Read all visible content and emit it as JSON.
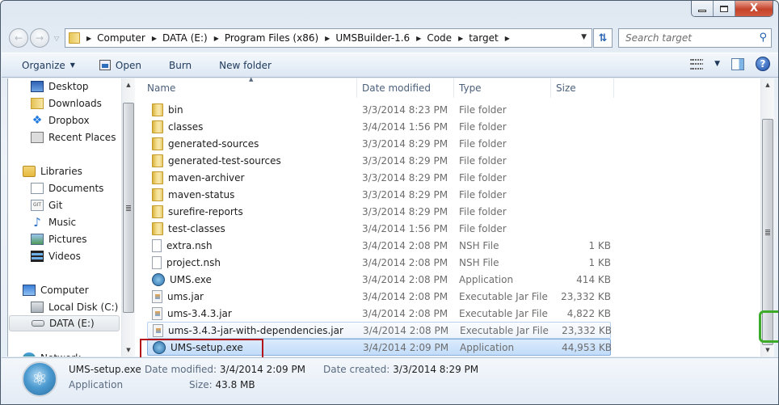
{
  "window": {
    "controls": {
      "minimize": "minimize",
      "maximize": "maximize",
      "close": "X"
    }
  },
  "nav": {
    "back_icon": "back-arrow",
    "forward_icon": "forward-arrow",
    "breadcrumbs": [
      "Computer",
      "DATA (E:)",
      "Program Files (x86)",
      "UMSBuilder-1.6",
      "Code",
      "target"
    ],
    "search_placeholder": "Search target"
  },
  "toolbar": {
    "organize": "Organize",
    "open": "Open",
    "burn": "Burn",
    "new_folder": "New folder",
    "help": "?"
  },
  "sidebar": {
    "favorites": [
      "Desktop",
      "Downloads",
      "Dropbox",
      "Recent Places"
    ],
    "libraries_label": "Libraries",
    "libraries": [
      "Documents",
      "Git",
      "Music",
      "Pictures",
      "Videos"
    ],
    "computer_label": "Computer",
    "drives": [
      "Local Disk (C:)",
      "DATA (E:)"
    ],
    "network_label": "Network",
    "selected": "DATA (E:)"
  },
  "columns": {
    "name": "Name",
    "date": "Date modified",
    "type": "Type",
    "size": "Size"
  },
  "files": [
    {
      "name": "bin",
      "date": "3/3/2014 8:23 PM",
      "type": "File folder",
      "size": "",
      "icon": "folder"
    },
    {
      "name": "classes",
      "date": "3/4/2014 1:56 PM",
      "type": "File folder",
      "size": "",
      "icon": "folder"
    },
    {
      "name": "generated-sources",
      "date": "3/3/2014 8:29 PM",
      "type": "File folder",
      "size": "",
      "icon": "folder"
    },
    {
      "name": "generated-test-sources",
      "date": "3/3/2014 8:29 PM",
      "type": "File folder",
      "size": "",
      "icon": "folder"
    },
    {
      "name": "maven-archiver",
      "date": "3/3/2014 8:29 PM",
      "type": "File folder",
      "size": "",
      "icon": "folder"
    },
    {
      "name": "maven-status",
      "date": "3/3/2014 8:29 PM",
      "type": "File folder",
      "size": "",
      "icon": "folder"
    },
    {
      "name": "surefire-reports",
      "date": "3/3/2014 8:29 PM",
      "type": "File folder",
      "size": "",
      "icon": "folder"
    },
    {
      "name": "test-classes",
      "date": "3/4/2014 1:56 PM",
      "type": "File folder",
      "size": "",
      "icon": "folder"
    },
    {
      "name": "extra.nsh",
      "date": "3/4/2014 2:08 PM",
      "type": "NSH File",
      "size": "1 KB",
      "icon": "blank"
    },
    {
      "name": "project.nsh",
      "date": "3/4/2014 2:08 PM",
      "type": "NSH File",
      "size": "1 KB",
      "icon": "blank"
    },
    {
      "name": "UMS.exe",
      "date": "3/4/2014 2:08 PM",
      "type": "Application",
      "size": "414 KB",
      "icon": "exe"
    },
    {
      "name": "ums.jar",
      "date": "3/4/2014 2:08 PM",
      "type": "Executable Jar File",
      "size": "23,332 KB",
      "icon": "jar"
    },
    {
      "name": "ums-3.4.3.jar",
      "date": "3/4/2014 2:08 PM",
      "type": "Executable Jar File",
      "size": "4,822 KB",
      "icon": "jar"
    },
    {
      "name": "ums-3.4.3-jar-with-dependencies.jar",
      "date": "3/4/2014 2:08 PM",
      "type": "Executable Jar File",
      "size": "23,332 KB",
      "icon": "jar"
    },
    {
      "name": "UMS-setup.exe",
      "date": "3/4/2014 2:09 PM",
      "type": "Application",
      "size": "44,953 KB",
      "icon": "exe"
    }
  ],
  "details": {
    "filename": "UMS-setup.exe",
    "filetype": "Application",
    "date_modified_label": "Date modified:",
    "date_modified": "3/4/2014 2:09 PM",
    "size_label": "Size:",
    "size": "43.8 MB",
    "date_created_label": "Date created:",
    "date_created": "3/3/2014 8:29 PM"
  },
  "colors": {
    "selection": "#c1dcfa",
    "highlight_red": "#b3141b",
    "highlight_green": "#3dab2a"
  }
}
